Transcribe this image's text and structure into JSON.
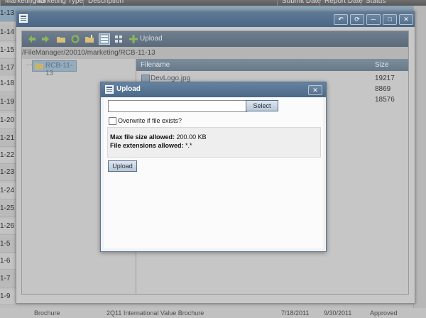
{
  "background": {
    "columns": [
      "Marketing ID",
      "Marketing Type",
      "Description",
      "Submit Date",
      "Report Date",
      "Status"
    ],
    "row_ids": [
      "1-13",
      "1-14",
      "1-15",
      "1-17",
      "1-18",
      "1-19",
      "1-20",
      "1-21",
      "1-22",
      "1-23",
      "1-24",
      "1-25",
      "1-26",
      "1-5",
      "1-6",
      "1-7",
      "1-9"
    ],
    "last_row": {
      "type": "Brochure",
      "description": "2Q11 International Value Brochure",
      "submit_date": "7/18/2011",
      "report_date": "9/30/2011",
      "status": "Approved"
    }
  },
  "file_manager": {
    "window_buttons": [
      "restore",
      "refresh",
      "minimize",
      "maximize",
      "close"
    ],
    "toolbar": {
      "upload_label": "Upload"
    },
    "path": "/FileManager/20010/marketing/RCB-11-13",
    "tree": {
      "selected_node": "RCB-11-13"
    },
    "list": {
      "columns": {
        "filename": "Filename",
        "size": "Size"
      },
      "rows": [
        {
          "name": "DevLogo.jpg",
          "size": "19217"
        },
        {
          "name": "",
          "size": "8869"
        },
        {
          "name": "",
          "size": "18576"
        }
      ]
    }
  },
  "upload_dialog": {
    "title": "Upload",
    "file_value": "",
    "select_label": "Select",
    "overwrite_label": "Overwrite if file exists?",
    "overwrite_checked": false,
    "max_size_label": "Max file size allowed:",
    "max_size_value": "200.00 KB",
    "extensions_label": "File extensions allowed:",
    "extensions_value": "*.*",
    "upload_button": "Upload"
  },
  "colors": {
    "titlebar": "#4c6987",
    "accent": "#56708c"
  }
}
